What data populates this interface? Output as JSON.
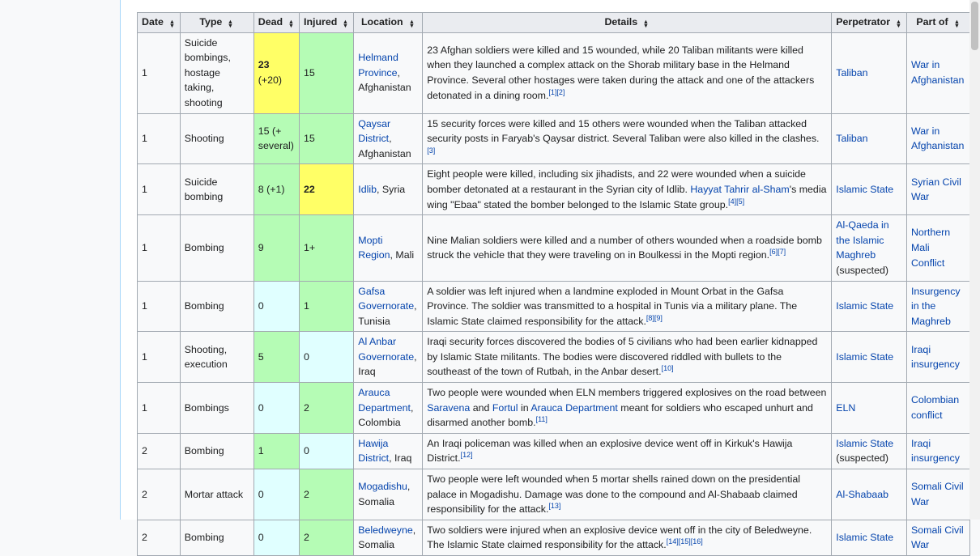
{
  "headers": [
    "Date",
    "Type",
    "Dead",
    "Injured",
    "Location",
    "Details",
    "Perpetrator",
    "Part of"
  ],
  "colors": {
    "yellow": "#ffff66",
    "green": "#b5fcb5",
    "cyan": "#e0ffff",
    "link": "#0645ad"
  },
  "rows": [
    {
      "date": "1",
      "type": "Suicide bombings, hostage taking, shooting",
      "dead": "23",
      "dead_extra": "(+20)",
      "dead_bold": true,
      "dead_color": "y",
      "injured": "15",
      "injured_color": "g",
      "location": [
        {
          "t": "Helmand Province",
          "link": true
        },
        {
          "t": ", Afghanistan"
        }
      ],
      "details": [
        {
          "t": "23 Afghan soldiers were killed and 15 wounded, while 20 Taliban militants were killed when they launched a complex attack on the Shorab military base in the Helmand Province. Several other hostages were taken during the attack and one of the attackers detonated in a dining room."
        }
      ],
      "refs": "[1][2]",
      "perpetrator": [
        {
          "t": "Taliban",
          "link": true
        }
      ],
      "part_of": "War in Afghanistan"
    },
    {
      "date": "1",
      "type": "Shooting",
      "dead": "15 (+ several)",
      "dead_color": "g",
      "injured": "15",
      "injured_color": "g",
      "location": [
        {
          "t": "Qaysar District",
          "link": true
        },
        {
          "t": ", Afghanistan"
        }
      ],
      "details": [
        {
          "t": "15 security forces were killed and 15 others were wounded when the Taliban attacked security posts in Faryab's Qaysar district. Several Taliban were also killed in the clashes."
        }
      ],
      "refs": "[3]",
      "perpetrator": [
        {
          "t": "Taliban",
          "link": true
        }
      ],
      "part_of": "War in Afghanistan"
    },
    {
      "date": "1",
      "type": "Suicide bombing",
      "dead": "8 (+1)",
      "dead_color": "g",
      "injured": "22",
      "injured_bold": true,
      "injured_color": "y",
      "location": [
        {
          "t": "Idlib",
          "link": true
        },
        {
          "t": ", Syria"
        }
      ],
      "details": [
        {
          "t": "Eight people were killed, including six jihadists, and 22 were wounded when a suicide bomber detonated at a restaurant in the Syrian city of Idlib. "
        },
        {
          "t": "Hayyat Tahrir al-Sham",
          "link": true
        },
        {
          "t": "'s media wing \"Ebaa\" stated the bomber belonged to the Islamic State group."
        }
      ],
      "refs": "[4][5]",
      "perpetrator": [
        {
          "t": "Islamic State",
          "link": true
        }
      ],
      "part_of": "Syrian Civil War"
    },
    {
      "date": "1",
      "type": "Bombing",
      "dead": "9",
      "dead_color": "g",
      "injured": "1+",
      "injured_color": "g",
      "location": [
        {
          "t": "Mopti Region",
          "link": true
        },
        {
          "t": ", Mali"
        }
      ],
      "details": [
        {
          "t": "Nine Malian soldiers were killed and a number of others wounded when a roadside bomb struck the vehicle that they were traveling on in Boulkessi in the Mopti region."
        }
      ],
      "refs": "[6][7]",
      "perpetrator": [
        {
          "t": "Al-Qaeda in the Islamic Maghreb",
          "link": true
        },
        {
          "t": " (suspected)"
        }
      ],
      "part_of": "Northern Mali Conflict"
    },
    {
      "date": "1",
      "type": "Bombing",
      "dead": "0",
      "dead_color": "c",
      "injured": "1",
      "injured_color": "g",
      "location": [
        {
          "t": "Gafsa Governorate",
          "link": true
        },
        {
          "t": ", Tunisia"
        }
      ],
      "details": [
        {
          "t": "A soldier was left injured when a landmine exploded in Mount Orbat in the Gafsa Province. The soldier was transmitted to a hospital in Tunis via a military plane. The Islamic State claimed responsibility for the attack."
        }
      ],
      "refs": "[8][9]",
      "perpetrator": [
        {
          "t": "Islamic State",
          "link": true
        }
      ],
      "part_of": "Insurgency in the Maghreb"
    },
    {
      "date": "1",
      "type": "Shooting, execution",
      "dead": "5",
      "dead_color": "g",
      "injured": "0",
      "injured_color": "c",
      "location": [
        {
          "t": "Al Anbar Governorate",
          "link": true
        },
        {
          "t": ", Iraq"
        }
      ],
      "details": [
        {
          "t": "Iraqi security forces discovered the bodies of 5 civilians who had been earlier kidnapped by Islamic State militants. The bodies were discovered riddled with bullets to the southeast of the town of Rutbah, in the Anbar desert."
        }
      ],
      "refs": "[10]",
      "perpetrator": [
        {
          "t": "Islamic State",
          "link": true
        }
      ],
      "part_of": "Iraqi insurgency"
    },
    {
      "date": "1",
      "type": "Bombings",
      "dead": "0",
      "dead_color": "c",
      "injured": "2",
      "injured_color": "g",
      "location": [
        {
          "t": "Arauca Department",
          "link": true
        },
        {
          "t": ", Colombia"
        }
      ],
      "details": [
        {
          "t": "Two people were wounded when ELN members triggered explosives on the road between "
        },
        {
          "t": "Saravena",
          "link": true
        },
        {
          "t": " and "
        },
        {
          "t": "Fortul",
          "link": true
        },
        {
          "t": " in "
        },
        {
          "t": "Arauca Department",
          "link": true
        },
        {
          "t": " meant for soldiers who escaped unhurt and disarmed another bomb."
        }
      ],
      "refs": "[11]",
      "perpetrator": [
        {
          "t": "ELN",
          "link": true
        }
      ],
      "part_of": "Colombian conflict"
    },
    {
      "date": "2",
      "type": "Bombing",
      "dead": "1",
      "dead_color": "g",
      "injured": "0",
      "injured_color": "c",
      "location": [
        {
          "t": "Hawija District",
          "link": true
        },
        {
          "t": ", Iraq"
        }
      ],
      "details": [
        {
          "t": "An Iraqi policeman was killed when an explosive device went off in Kirkuk's Hawija District."
        }
      ],
      "refs": "[12]",
      "perpetrator": [
        {
          "t": "Islamic State",
          "link": true
        },
        {
          "t": " (suspected)"
        }
      ],
      "part_of": "Iraqi insurgency"
    },
    {
      "date": "2",
      "type": "Mortar attack",
      "dead": "0",
      "dead_color": "c",
      "injured": "2",
      "injured_color": "g",
      "location": [
        {
          "t": "Mogadishu",
          "link": true
        },
        {
          "t": ", Somalia"
        }
      ],
      "details": [
        {
          "t": "Two people were left wounded when 5 mortar shells rained down on the presidential palace in Mogadishu. Damage was done to the compound and Al-Shabaab claimed responsibility for the attack."
        }
      ],
      "refs": "[13]",
      "perpetrator": [
        {
          "t": "Al-Shabaab",
          "link": true
        }
      ],
      "part_of": "Somali Civil War"
    },
    {
      "date": "2",
      "type": "Bombing",
      "dead": "0",
      "dead_color": "c",
      "injured": "2",
      "injured_color": "g",
      "location": [
        {
          "t": "Beledweyne",
          "link": true
        },
        {
          "t": ", Somalia"
        }
      ],
      "details": [
        {
          "t": "Two soldiers were injured when an explosive device went off in the city of Beledweyne. The Islamic State claimed responsibility for the attack."
        }
      ],
      "refs": "[14][15][16]",
      "perpetrator": [
        {
          "t": "Islamic State",
          "link": true
        }
      ],
      "part_of": "Somali Civil War"
    }
  ]
}
